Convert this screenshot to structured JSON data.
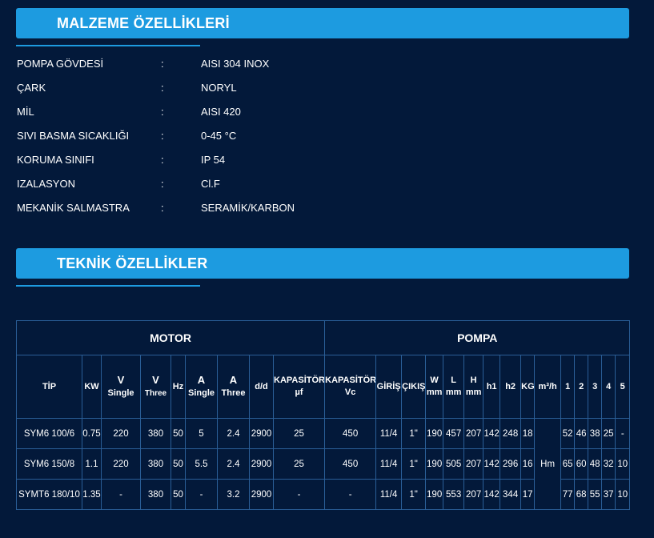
{
  "material": {
    "title": "MALZEME ÖZELLİKLERİ",
    "rows": [
      {
        "label": "POMPA GÖVDESİ",
        "sep": ":",
        "value": "AISI 304 INOX"
      },
      {
        "label": "ÇARK",
        "sep": ":",
        "value": "NORYL"
      },
      {
        "label": "MİL",
        "sep": ":",
        "value": "AISI 420"
      },
      {
        "label": "SIVI BASMA SICAKLIĞI",
        "sep": ":",
        "value": "0-45 °C"
      },
      {
        "label": "KORUMA SINIFI",
        "sep": ":",
        "value": "IP 54"
      },
      {
        "label": "IZALASYON",
        "sep": ":",
        "value": "Cl.F"
      },
      {
        "label": "MEKANİK SALMASTRA",
        "sep": ":",
        "value": "SERAMİK/KARBON"
      }
    ]
  },
  "technical": {
    "title": "TEKNİK ÖZELLİKLER",
    "group_headers": {
      "motor": "MOTOR",
      "pump": "POMPA"
    },
    "headers": {
      "tip": "TİP",
      "kw": "KW",
      "v_single": {
        "main": "V",
        "sub": "Single"
      },
      "v_three": {
        "main": "V",
        "sub": "Three"
      },
      "hz": "Hz",
      "a_single": {
        "main": "A",
        "sub": "Single"
      },
      "a_three": {
        "main": "A",
        "sub": "Three"
      },
      "dd": "d/d",
      "cap_uf": {
        "main": "KAPASİTÖR",
        "sub": "µf"
      },
      "cap_vc": {
        "main": "KAPASİTÖR",
        "sub": "Vc"
      },
      "giris": "GİRİŞ",
      "cikis": "ÇIKIŞ",
      "w": {
        "main": "W",
        "sub": "mm"
      },
      "l": {
        "main": "L",
        "sub": "mm"
      },
      "h": {
        "main": "H",
        "sub": "mm"
      },
      "h1": "h1",
      "h2": "h2",
      "kg": "KG",
      "m3h": "m³/h",
      "q1": "1",
      "q2": "2",
      "q3": "3",
      "q4": "4",
      "q5": "5"
    },
    "hm_label": "Hm",
    "rows": [
      {
        "tip": "SYM6 100/6",
        "kw": "0.75",
        "v_single": "220",
        "v_three": "380",
        "hz": "50",
        "a_single": "5",
        "a_three": "2.4",
        "dd": "2900",
        "cap_uf": "25",
        "cap_vc": "450",
        "giris": "11/4",
        "cikis": "1\"",
        "w": "190",
        "l": "457",
        "h": "207",
        "h1": "142",
        "h2": "248",
        "kg": "18",
        "q1": "52",
        "q2": "46",
        "q3": "38",
        "q4": "25",
        "q5": "-"
      },
      {
        "tip": "SYM6 150/8",
        "kw": "1.1",
        "v_single": "220",
        "v_three": "380",
        "hz": "50",
        "a_single": "5.5",
        "a_three": "2.4",
        "dd": "2900",
        "cap_uf": "25",
        "cap_vc": "450",
        "giris": "11/4",
        "cikis": "1\"",
        "w": "190",
        "l": "505",
        "h": "207",
        "h1": "142",
        "h2": "296",
        "kg": "16",
        "q1": "65",
        "q2": "60",
        "q3": "48",
        "q4": "32",
        "q5": "10"
      },
      {
        "tip": "SYMT6 180/10",
        "kw": "1.35",
        "v_single": "-",
        "v_three": "380",
        "hz": "50",
        "a_single": "-",
        "a_three": "3.2",
        "dd": "2900",
        "cap_uf": "-",
        "cap_vc": "-",
        "giris": "11/4",
        "cikis": "1\"",
        "w": "190",
        "l": "553",
        "h": "207",
        "h1": "142",
        "h2": "344",
        "kg": "17",
        "q1": "77",
        "q2": "68",
        "q3": "55",
        "q4": "37",
        "q5": "10"
      }
    ]
  },
  "colors": {
    "background": "#03193a",
    "accent": "#1d9be0",
    "border": "#2a5e97"
  }
}
